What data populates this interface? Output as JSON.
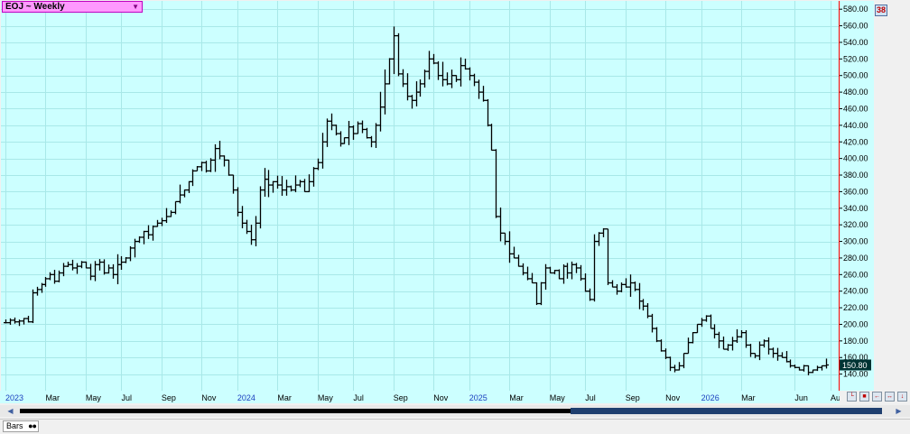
{
  "window": {
    "title": "EOJ ~ Weekly",
    "scale_badge": "38"
  },
  "status_bar": {
    "tab_label": "Bars"
  },
  "colors": {
    "plot_bg": "#ccffff",
    "bars": "#000000",
    "grid": "#a8e8e8",
    "cursor_line": "#ff0000",
    "last_price_bg": "#003333",
    "year_label": "#1a3fbf"
  },
  "icons": {
    "dropdown": "chevron-down-icon",
    "scroll_left": "arrow-left-icon",
    "scroll_right": "arrow-right-icon",
    "tab_dots": "circle-icons"
  },
  "chart_data": {
    "type": "ohlc",
    "interval": "weekly",
    "last_price": "150.80",
    "ylim": [
      120,
      590
    ],
    "y_ticks": [
      140,
      160,
      180,
      200,
      220,
      240,
      260,
      280,
      300,
      320,
      340,
      360,
      380,
      400,
      420,
      440,
      460,
      480,
      500,
      520,
      540,
      560,
      580
    ],
    "y_tick_labels": [
      "140.00",
      "160.00",
      "180.00",
      "200.00",
      "220.00",
      "240.00",
      "260.00",
      "280.00",
      "300.00",
      "320.00",
      "340.00",
      "360.00",
      "380.00",
      "400.00",
      "420.00",
      "440.00",
      "460.00",
      "480.00",
      "500.00",
      "520.00",
      "540.00",
      "560.00",
      "580.00"
    ],
    "x_labels": [
      {
        "label": "2023",
        "week": 0,
        "year": true
      },
      {
        "label": "Mar",
        "week": 9,
        "year": false
      },
      {
        "label": "May",
        "week": 18,
        "year": false
      },
      {
        "label": "Jul",
        "week": 26,
        "year": false
      },
      {
        "label": "Sep",
        "week": 35,
        "year": false
      },
      {
        "label": "Nov",
        "week": 44,
        "year": false
      },
      {
        "label": "2024",
        "week": 52,
        "year": true
      },
      {
        "label": "Mar",
        "week": 61,
        "year": false
      },
      {
        "label": "May",
        "week": 70,
        "year": false
      },
      {
        "label": "Jul",
        "week": 78,
        "year": false
      },
      {
        "label": "Sep",
        "week": 87,
        "year": false
      },
      {
        "label": "Nov",
        "week": 96,
        "year": false
      },
      {
        "label": "2025",
        "week": 104,
        "year": true
      },
      {
        "label": "Mar",
        "week": 113,
        "year": false
      },
      {
        "label": "May",
        "week": 122,
        "year": false
      },
      {
        "label": "Jul",
        "week": 130,
        "year": false
      },
      {
        "label": "Sep",
        "week": 139,
        "year": false
      },
      {
        "label": "Nov",
        "week": 148,
        "year": false
      },
      {
        "label": "2026",
        "week": 156,
        "year": true
      },
      {
        "label": "Mar",
        "week": 165,
        "year": false
      },
      {
        "label": "Jun",
        "week": 177,
        "year": false
      },
      {
        "label": "Aug",
        "week": 185,
        "year": false
      }
    ],
    "close_series": [
      202,
      205,
      203,
      204,
      207,
      203,
      238,
      242,
      248,
      255,
      260,
      252,
      262,
      270,
      272,
      268,
      270,
      275,
      268,
      258,
      272,
      275,
      262,
      268,
      260,
      272,
      275,
      280,
      292,
      300,
      305,
      312,
      308,
      318,
      322,
      325,
      330,
      335,
      348,
      356,
      362,
      372,
      385,
      390,
      395,
      385,
      398,
      412,
      403,
      398,
      380,
      362,
      335,
      322,
      312,
      302,
      322,
      362,
      375,
      368,
      372,
      368,
      362,
      366,
      362,
      368,
      372,
      360,
      372,
      388,
      395,
      420,
      445,
      440,
      430,
      418,
      425,
      438,
      430,
      442,
      435,
      425,
      420,
      440,
      462,
      490,
      520,
      548,
      502,
      490,
      475,
      470,
      480,
      490,
      505,
      520,
      515,
      500,
      495,
      490,
      500,
      495,
      512,
      508,
      500,
      492,
      480,
      470,
      440,
      410,
      330,
      310,
      300,
      285,
      280,
      270,
      262,
      255,
      250,
      225,
      250,
      268,
      262,
      265,
      255,
      270,
      262,
      272,
      268,
      255,
      240,
      230,
      300,
      310,
      315,
      250,
      245,
      240,
      248,
      245,
      250,
      242,
      228,
      222,
      210,
      195,
      180,
      168,
      160,
      148,
      145,
      150,
      165,
      178,
      190,
      200,
      205,
      210,
      195,
      188,
      180,
      170,
      175,
      180,
      185,
      190,
      175,
      165,
      162,
      175,
      180,
      170,
      165,
      162,
      160,
      155,
      150,
      148,
      145,
      150,
      142,
      145,
      148,
      150,
      151
    ]
  }
}
